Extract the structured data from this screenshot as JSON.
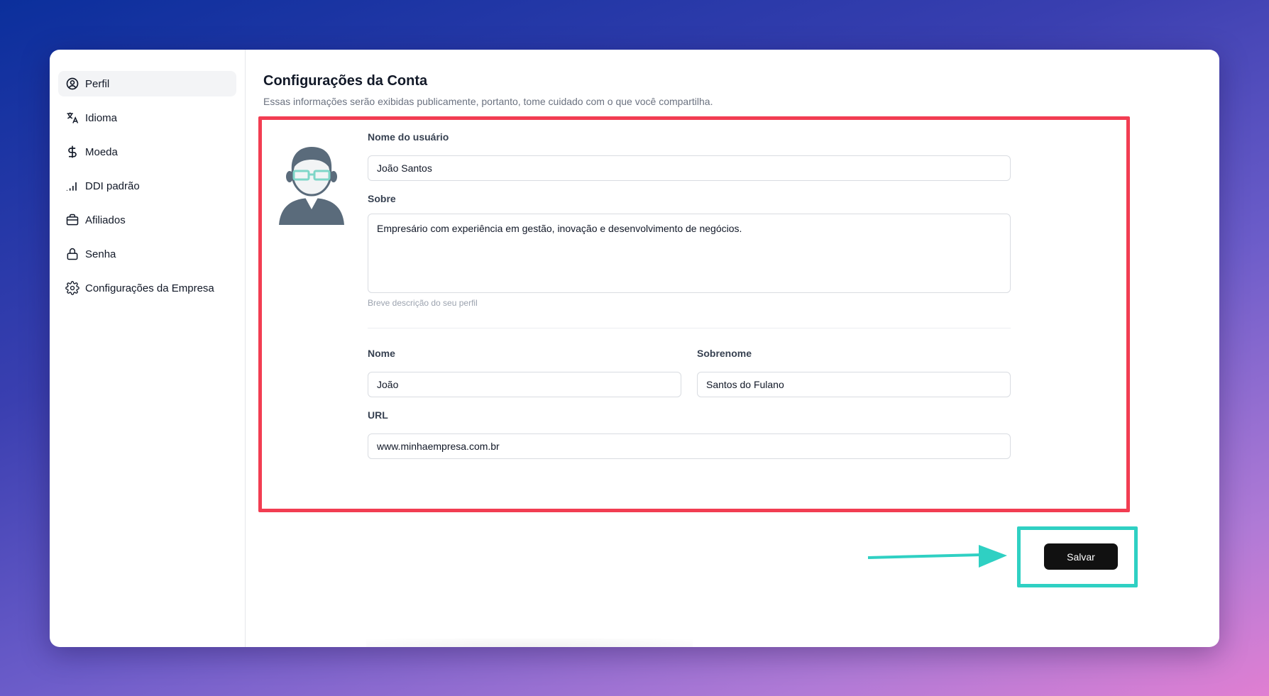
{
  "sidebar": {
    "items": [
      {
        "label": "Perfil",
        "icon": "user-circle-icon",
        "active": true
      },
      {
        "label": "Idioma",
        "icon": "translate-icon",
        "active": false
      },
      {
        "label": "Moeda",
        "icon": "dollar-icon",
        "active": false
      },
      {
        "label": "DDI padrão",
        "icon": "signal-bars-icon",
        "active": false
      },
      {
        "label": "Afiliados",
        "icon": "briefcase-icon",
        "active": false
      },
      {
        "label": "Senha",
        "icon": "lock-icon",
        "active": false
      },
      {
        "label": "Configurações da Empresa",
        "icon": "gear-icon",
        "active": false
      }
    ]
  },
  "header": {
    "title": "Configurações da Conta",
    "subtitle": "Essas informações serão exibidas publicamente, portanto, tome cuidado com o que você compartilha."
  },
  "form": {
    "username": {
      "label": "Nome do usuário",
      "value": "João Santos"
    },
    "about": {
      "label": "Sobre",
      "value": "Empresário com experiência em gestão, inovação e desenvolvimento de negócios.",
      "hint": "Breve descrição do seu perfil"
    },
    "first_name": {
      "label": "Nome",
      "value": "João"
    },
    "last_name": {
      "label": "Sobrenome",
      "value": "Santos do Fulano"
    },
    "url": {
      "label": "URL",
      "value": "www.minhaempresa.com.br"
    }
  },
  "actions": {
    "save_label": "Salvar"
  },
  "colors": {
    "highlight_red": "#f23d52",
    "highlight_teal": "#2fd0c3",
    "button_dark": "#111111"
  }
}
